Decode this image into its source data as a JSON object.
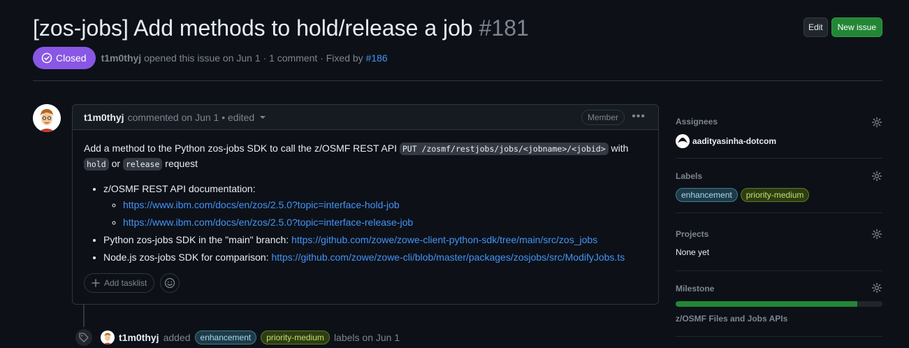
{
  "issue": {
    "title": "[zos-jobs] Add methods to hold/release a job",
    "number": "#181",
    "state": "Closed",
    "author": "t1m0thyj",
    "opened_text": "opened this issue on Jun 1 · 1 comment · Fixed by",
    "fixed_by": "#186",
    "edit_label": "Edit",
    "new_issue_label": "New issue"
  },
  "comment": {
    "author": "t1m0thyj",
    "when": "commented on Jun 1 • edited",
    "role": "Member",
    "body_intro_1": "Add a method to the Python zos-jobs SDK to call the z/OSMF REST API",
    "code_path": "PUT /zosmf/restjobs/jobs/<jobname>/<jobid>",
    "body_intro_2": "with",
    "code_hold": "hold",
    "body_or": "or",
    "code_release": "release",
    "body_intro_3": "request",
    "bullets": {
      "doc_label": "z/OSMF REST API documentation:",
      "doc_link_1": "https://www.ibm.com/docs/en/zos/2.5.0?topic=interface-hold-job",
      "doc_link_2": "https://www.ibm.com/docs/en/zos/2.5.0?topic=interface-release-job",
      "py_label": "Python zos-jobs SDK in the \"main\" branch:",
      "py_link": "https://github.com/zowe/zowe-client-python-sdk/tree/main/src/zos_jobs",
      "node_label": "Node.js zos-jobs SDK for comparison:",
      "node_link": "https://github.com/zowe/zowe-cli/blob/master/packages/zosjobs/src/ModifyJobs.ts"
    },
    "add_tasklist": "Add tasklist"
  },
  "timeline": {
    "author": "t1m0thyj",
    "added": "added",
    "label_1": "enhancement",
    "label_2": "priority-medium",
    "suffix": "labels on Jun 1"
  },
  "sidebar": {
    "assignees_heading": "Assignees",
    "assignee": "aadityasinha-dotcom",
    "labels_heading": "Labels",
    "label_1": "enhancement",
    "label_2": "priority-medium",
    "projects_heading": "Projects",
    "projects_value": "None yet",
    "milestone_heading": "Milestone",
    "milestone_progress": 0.88,
    "milestone_name": "z/OSMF Files and Jobs APIs"
  },
  "colors": {
    "closed": "#8957e5",
    "green": "#238636",
    "link": "#4493f8"
  }
}
